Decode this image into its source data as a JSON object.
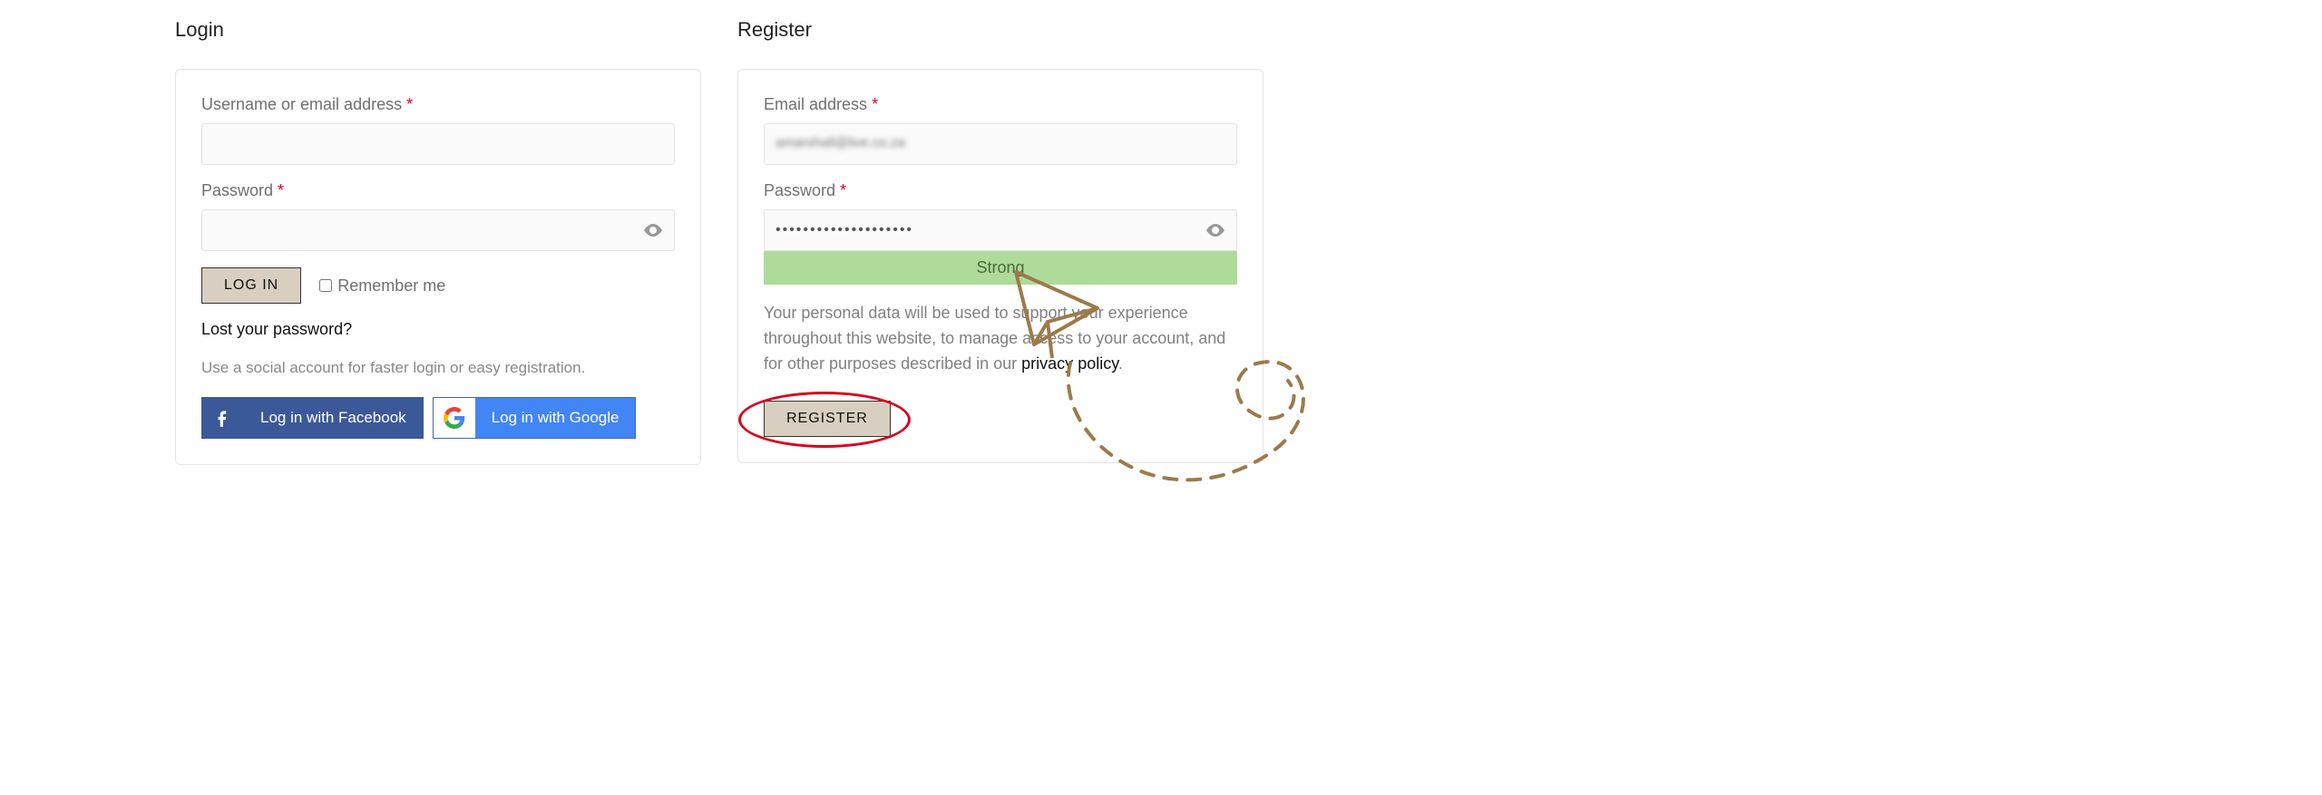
{
  "login": {
    "title": "Login",
    "username_label": "Username or email address",
    "password_label": "Password",
    "req": "*",
    "login_btn": "LOG IN",
    "remember_label": "Remember me",
    "lost_pw": "Lost your password?",
    "social_helper": "Use a social account for faster login or easy registration.",
    "fb_label": "Log in with Facebook",
    "g_label": "Log in with Google"
  },
  "register": {
    "title": "Register",
    "email_label": "Email address",
    "password_label": "Password",
    "req": "*",
    "email_value": "amarshall@live.co.za",
    "pw_value": "••••••••••••••••••••",
    "strength": "Strong",
    "privacy_text_1": "Your personal data will be used to support your experience throughout this website, to manage access to your account, and for other purposes described in our ",
    "privacy_link": "privacy policy",
    "privacy_text_2": ".",
    "register_btn": "REGISTER"
  }
}
